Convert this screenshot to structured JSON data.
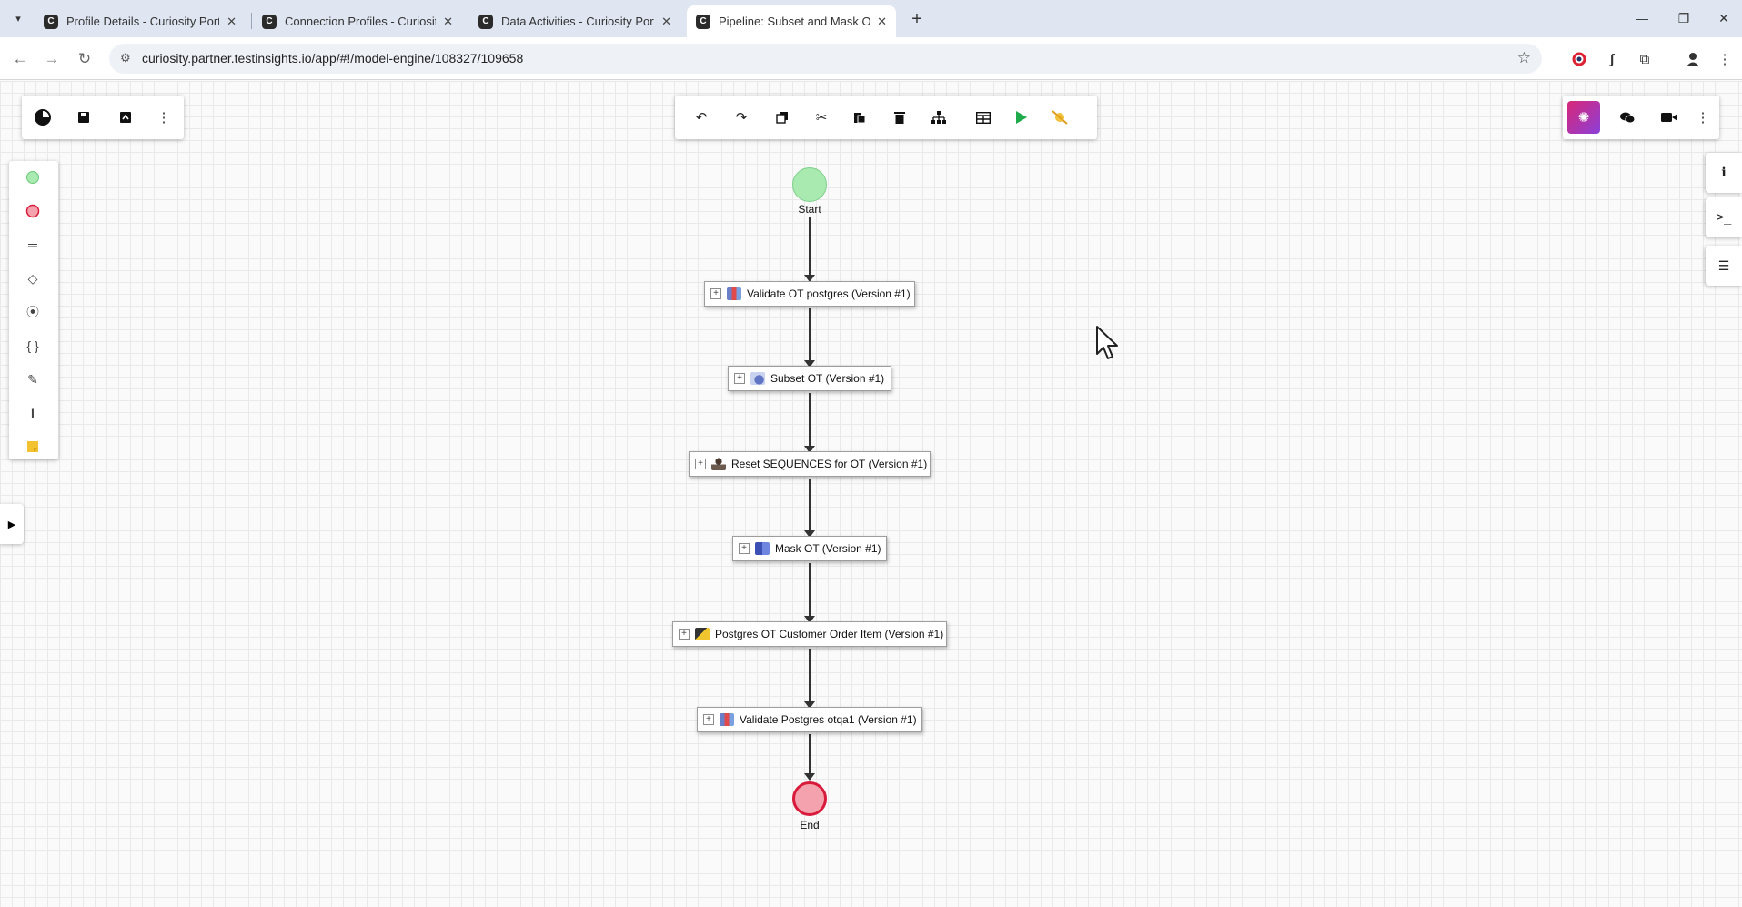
{
  "browser": {
    "tabs": [
      {
        "title": "Profile Details - Curiosity Portal",
        "active": false
      },
      {
        "title": "Connection Profiles - Curiosity",
        "active": false
      },
      {
        "title": "Data Activities - Curiosity Portal",
        "active": false
      },
      {
        "title": "Pipeline: Subset and Mask OT F",
        "active": true
      }
    ],
    "url": "curiosity.partner.testinsights.io/app/#!/model-engine/108327/109658"
  },
  "toolbar_left": [
    "logo-icon",
    "save-icon",
    "export-icon",
    "more-icon"
  ],
  "toolbar_center": [
    "undo-icon",
    "redo-icon",
    "copy-icon",
    "cut-icon",
    "paste-icon",
    "delete-icon",
    "hierarchy-icon",
    "table-icon",
    "run-icon",
    "clear-icon"
  ],
  "toolbar_right": [
    "ai-assistant-icon",
    "chat-icon",
    "video-icon",
    "more-icon"
  ],
  "palette": [
    "start-event-icon",
    "end-event-icon",
    "intermediate-icon",
    "gateway-icon",
    "subprocess-icon",
    "braces-icon",
    "edit-icon",
    "text-icon",
    "sticky-note-icon"
  ],
  "side_tabs": [
    "info-icon",
    "console-icon",
    "list-icon"
  ],
  "flow": {
    "start_label": "Start",
    "end_label": "End",
    "nodes": [
      {
        "label": "Validate OT postgres (Version #1)",
        "icon": "validate-icon"
      },
      {
        "label": "Subset OT (Version #1)",
        "icon": "subset-icon"
      },
      {
        "label": "Reset SEQUENCES for OT (Version #1)",
        "icon": "person-icon"
      },
      {
        "label": "Mask OT (Version #1)",
        "icon": "mask-icon"
      },
      {
        "label": "Postgres OT Customer Order Item (Version #1)",
        "icon": "database-folder-icon"
      },
      {
        "label": "Validate Postgres otqa1 (Version #1)",
        "icon": "validate-icon"
      }
    ]
  },
  "colors": {
    "start_fill": "#a8eab0",
    "end_fill": "#f4a3ae",
    "end_stroke": "#d81b3b",
    "run_green": "#1faa4c",
    "accent_purple": "#8b3fd9"
  }
}
